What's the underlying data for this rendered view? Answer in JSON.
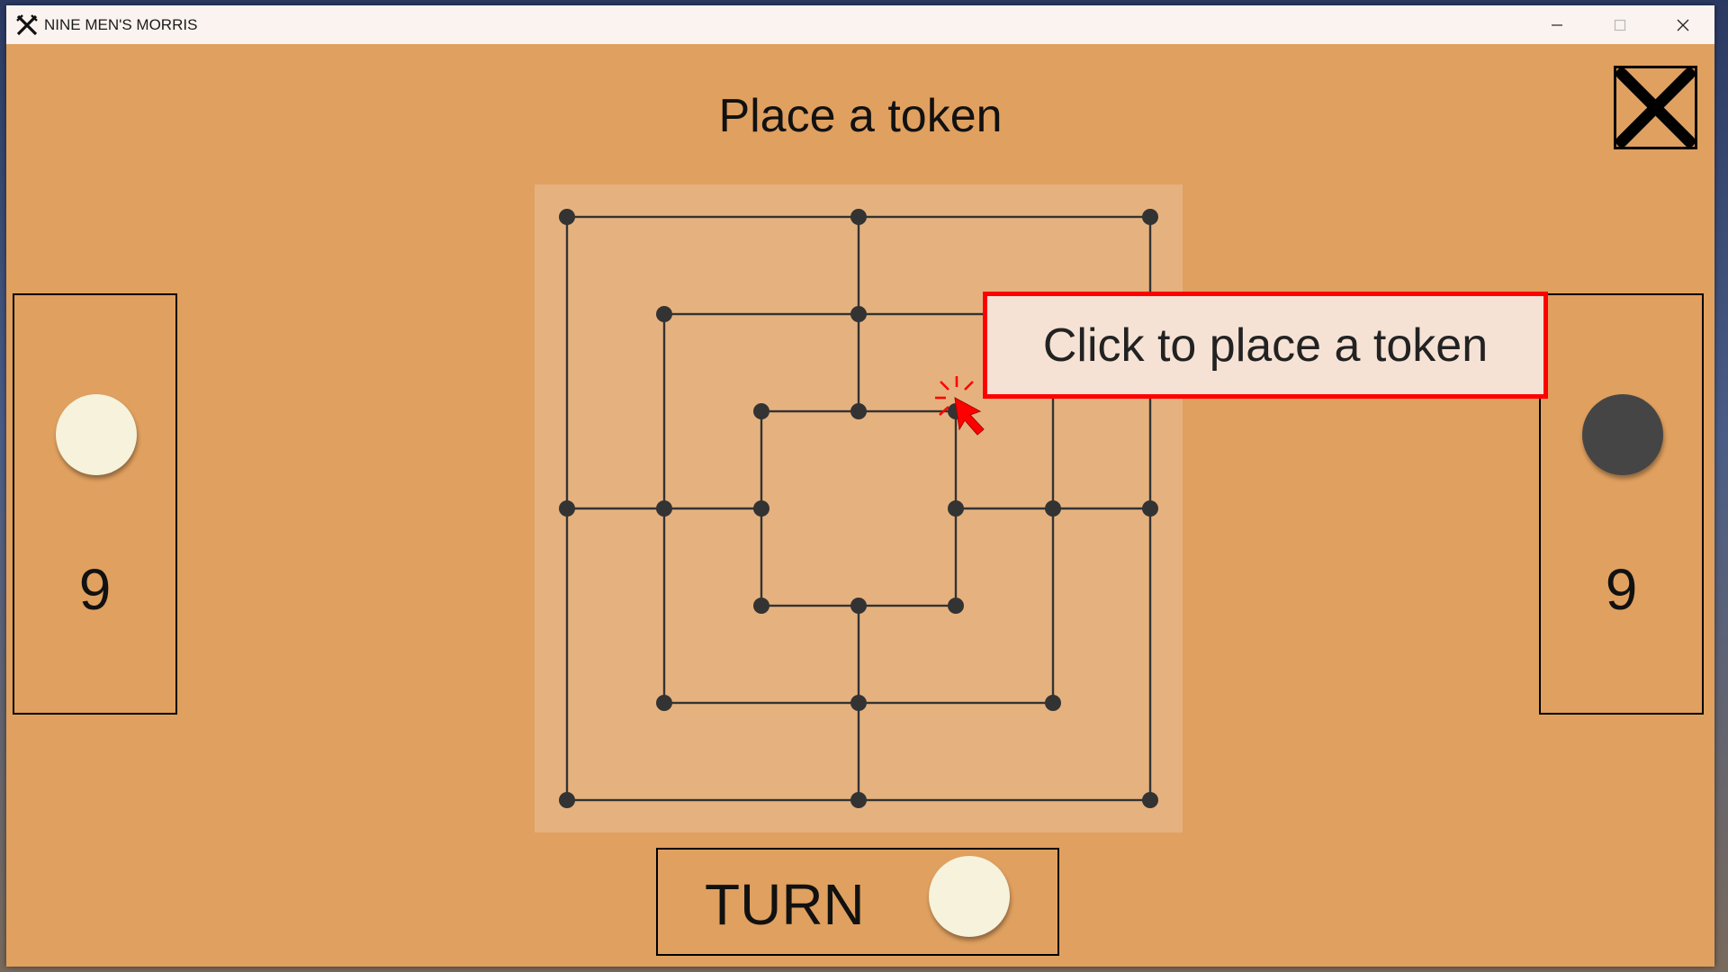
{
  "window": {
    "title": "NINE MEN'S MORRIS"
  },
  "game": {
    "status": "Place a token",
    "player_light_remaining": "9",
    "player_dark_remaining": "9",
    "turn_label": "TURN",
    "current_turn": "light"
  },
  "hint": {
    "text": "Click to place a token"
  },
  "icons": {
    "app": "crossed-swords-icon",
    "minimize": "minimize-icon",
    "maximize": "maximize-icon",
    "close": "close-icon",
    "exit_game": "x-icon",
    "pointer": "mouse-pointer-icon"
  },
  "colors": {
    "background": "#e0a05f",
    "board": "#e5b27f",
    "light_token": "#f6f2dc",
    "dark_token": "#454545",
    "highlight": "#ff0000"
  }
}
